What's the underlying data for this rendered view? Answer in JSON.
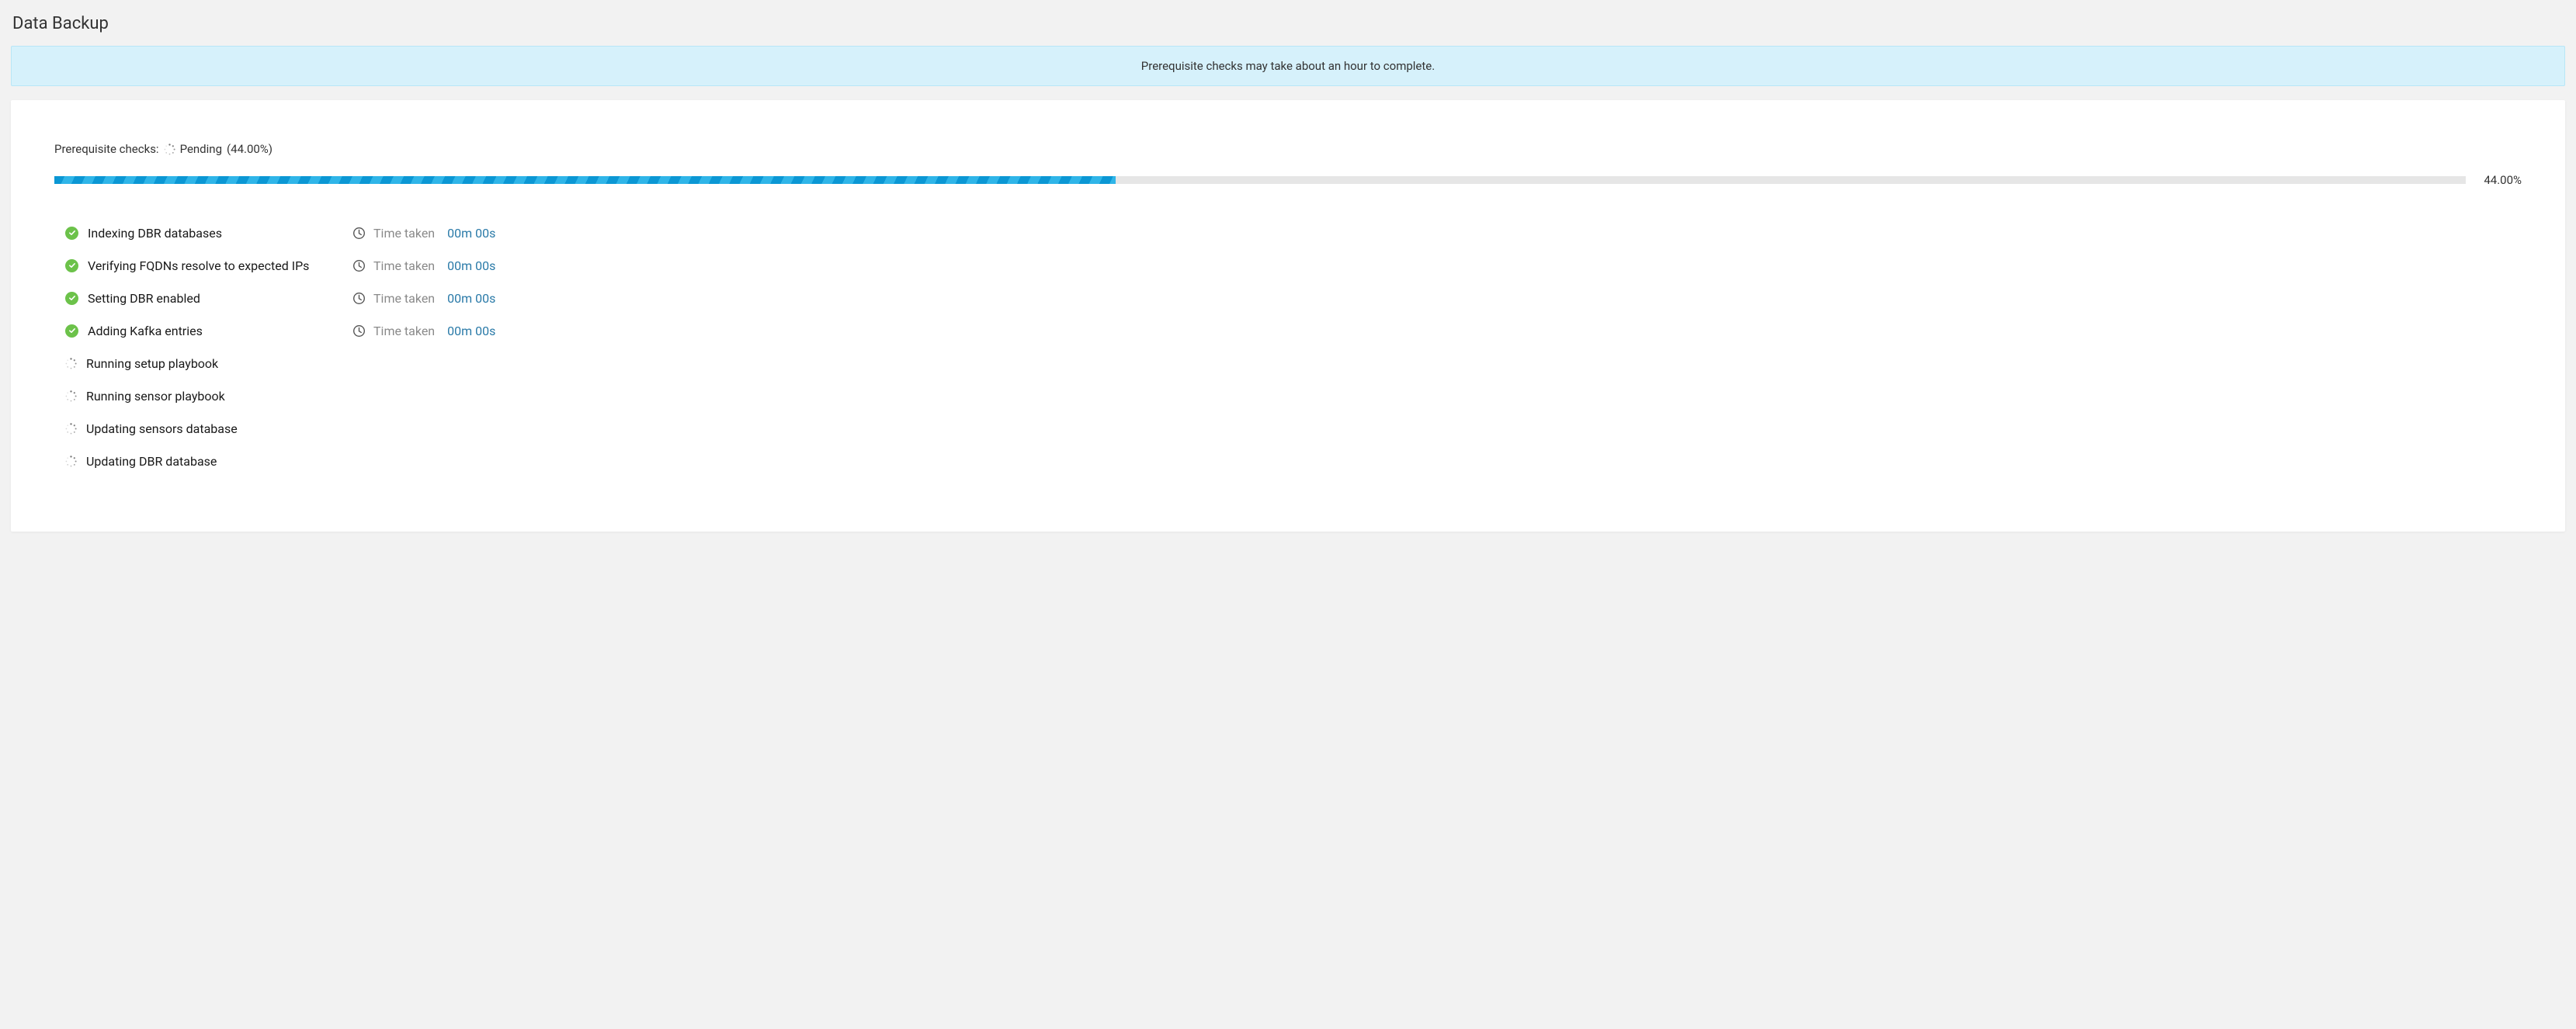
{
  "title": "Data Backup",
  "banner": "Prerequisite checks may take about an hour to complete.",
  "status": {
    "prefix": "Prerequisite checks:",
    "state": "Pending",
    "percent_display": "(44.00%)"
  },
  "progress": {
    "percent": 44,
    "percent_label": "44.00%"
  },
  "labels": {
    "time_taken": "Time taken"
  },
  "checks": [
    {
      "label": "Indexing DBR databases",
      "status": "success",
      "time": "00m 00s"
    },
    {
      "label": "Verifying FQDNs resolve to expected IPs",
      "status": "success",
      "time": "00m 00s"
    },
    {
      "label": "Setting DBR enabled",
      "status": "success",
      "time": "00m 00s"
    },
    {
      "label": "Adding Kafka entries",
      "status": "success",
      "time": "00m 00s"
    },
    {
      "label": "Running setup playbook",
      "status": "pending",
      "time": null
    },
    {
      "label": "Running sensor playbook",
      "status": "pending",
      "time": null
    },
    {
      "label": "Updating sensors database",
      "status": "pending",
      "time": null
    },
    {
      "label": "Updating DBR database",
      "status": "pending",
      "time": null
    }
  ]
}
